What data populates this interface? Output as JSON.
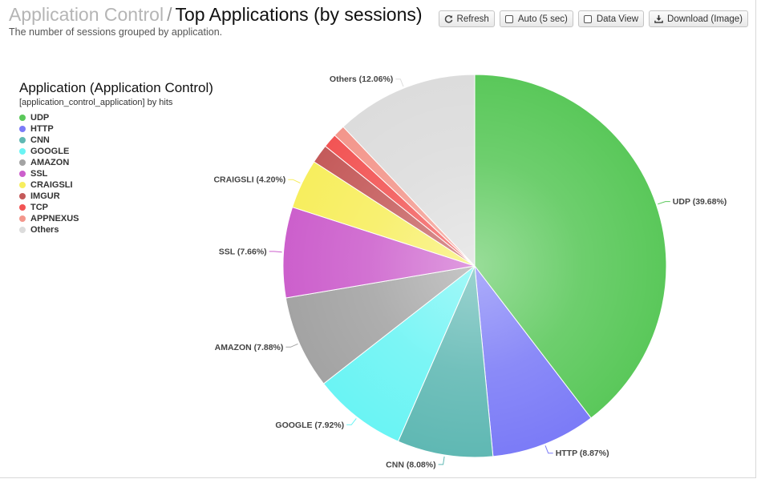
{
  "header": {
    "breadcrumb": "Application Control",
    "separator": "/",
    "title": "Top Applications (by sessions)",
    "subtitle": "The number of sessions grouped by application."
  },
  "toolbar": {
    "refresh_label": "Refresh",
    "auto_label": "Auto (5 sec)",
    "dataview_label": "Data View",
    "download_label": "Download (Image)"
  },
  "legend": {
    "title": "Application (Application Control)",
    "subtitle": "[application_control_application] by hits"
  },
  "chart_data": {
    "type": "pie",
    "categories": [
      "UDP",
      "HTTP",
      "CNN",
      "GOOGLE",
      "AMAZON",
      "SSL",
      "CRAIGSLI",
      "IMGUR",
      "TCP",
      "APPNEXUS",
      "Others"
    ],
    "values": [
      39.68,
      8.87,
      8.08,
      7.92,
      7.88,
      7.66,
      4.2,
      1.6,
      1.2,
      1.0,
      12.06
    ],
    "labels": [
      "UDP (39.68%)",
      "HTTP (8.87%)",
      "CNN (8.08%)",
      "GOOGLE (7.92%)",
      "AMAZON (7.88%)",
      "SSL (7.66%)",
      "CRAIGSLI (4.20%)",
      "",
      "",
      "",
      "Others (12.06%)"
    ],
    "colors": [
      "#5ac85a",
      "#7b7bf7",
      "#5fb8b3",
      "#6af4f4",
      "#a3a3a3",
      "#cc5fcc",
      "#f7ee5e",
      "#c45a5a",
      "#f25454",
      "#f3968b",
      "#dcdcdc"
    ],
    "legend_position": "top-left"
  }
}
